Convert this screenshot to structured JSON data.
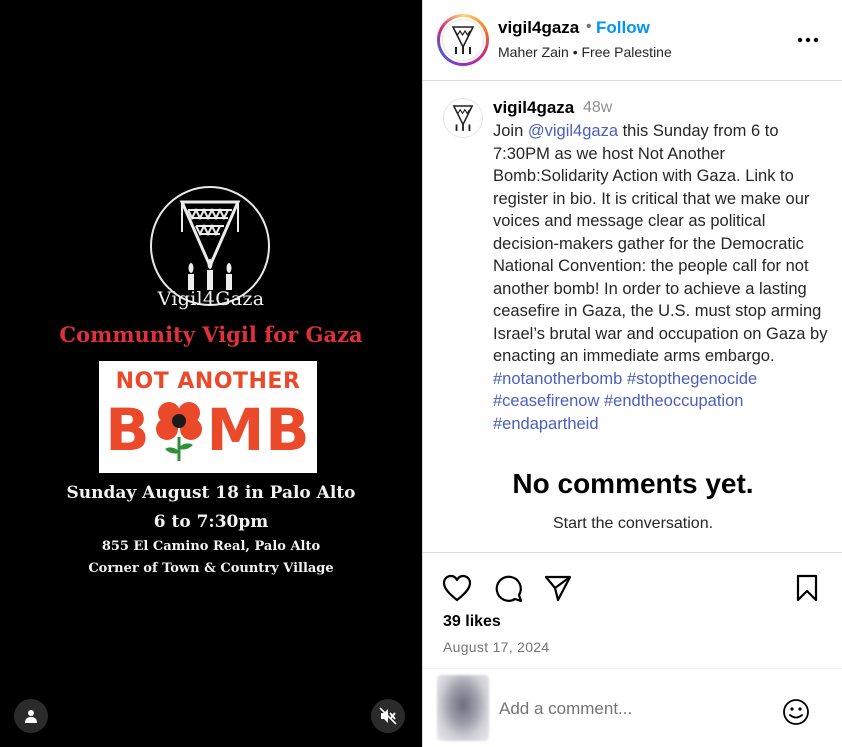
{
  "media": {
    "org_name": "Vigil4Gaza",
    "event_title": "Community Vigil for Gaza",
    "banner_line1": "NOT ANOTHER",
    "banner_line2_start": "B",
    "banner_line2_end": "MB",
    "date_line": "Sunday August 18 in Palo Alto",
    "time_line": "6 to 7:30pm",
    "address": "855 El Camino Real, Palo Alto",
    "location_note": "Corner of Town & Country Village",
    "tag_icon": "person-icon",
    "mute_icon": "speaker-muted-icon",
    "colors": {
      "background": "#000000",
      "title_red": "#e0303a",
      "banner_orange": "#ea4a2a"
    }
  },
  "header": {
    "username": "vigil4gaza",
    "separator": "•",
    "follow_label": "Follow",
    "audio": "Maher Zain • Free Palestine",
    "more_icon": "more-horizontal-icon"
  },
  "caption": {
    "username": "vigil4gaza",
    "age": "48w",
    "text_1": "Join ",
    "mention": "@vigil4gaza",
    "text_2": " this Sunday from 6 to 7:30PM as we host Not Another Bomb:Solidarity Action with Gaza. Link to register in bio. It is critical that we make our voices and message clear as political decision-makers gather for the Democratic National Convention: the people call for not another bomb! In order to achieve a lasting ceasefire in Gaza, the U.S. must stop arming Israel’s brutal war and occupation on Gaza by enacting an immediate arms embargo.",
    "hashtags": [
      "#notanotherbomb",
      "#stopthegenocide",
      "#ceasefirenow",
      "#endtheoccupation",
      "#endapartheid"
    ]
  },
  "comments": {
    "empty_title": "No comments yet.",
    "empty_subtitle": "Start the conversation."
  },
  "actions": {
    "icons": [
      "heart-icon",
      "comment-icon",
      "share-icon",
      "bookmark-icon"
    ],
    "likes": "39 likes",
    "date": "August 17, 2024"
  },
  "composer": {
    "placeholder": "Add a comment...",
    "emoji_icon": "emoji-icon"
  },
  "colors": {
    "follow_blue": "#0095f6",
    "link_blue": "#4a5fc1",
    "muted_gray": "#737373"
  }
}
